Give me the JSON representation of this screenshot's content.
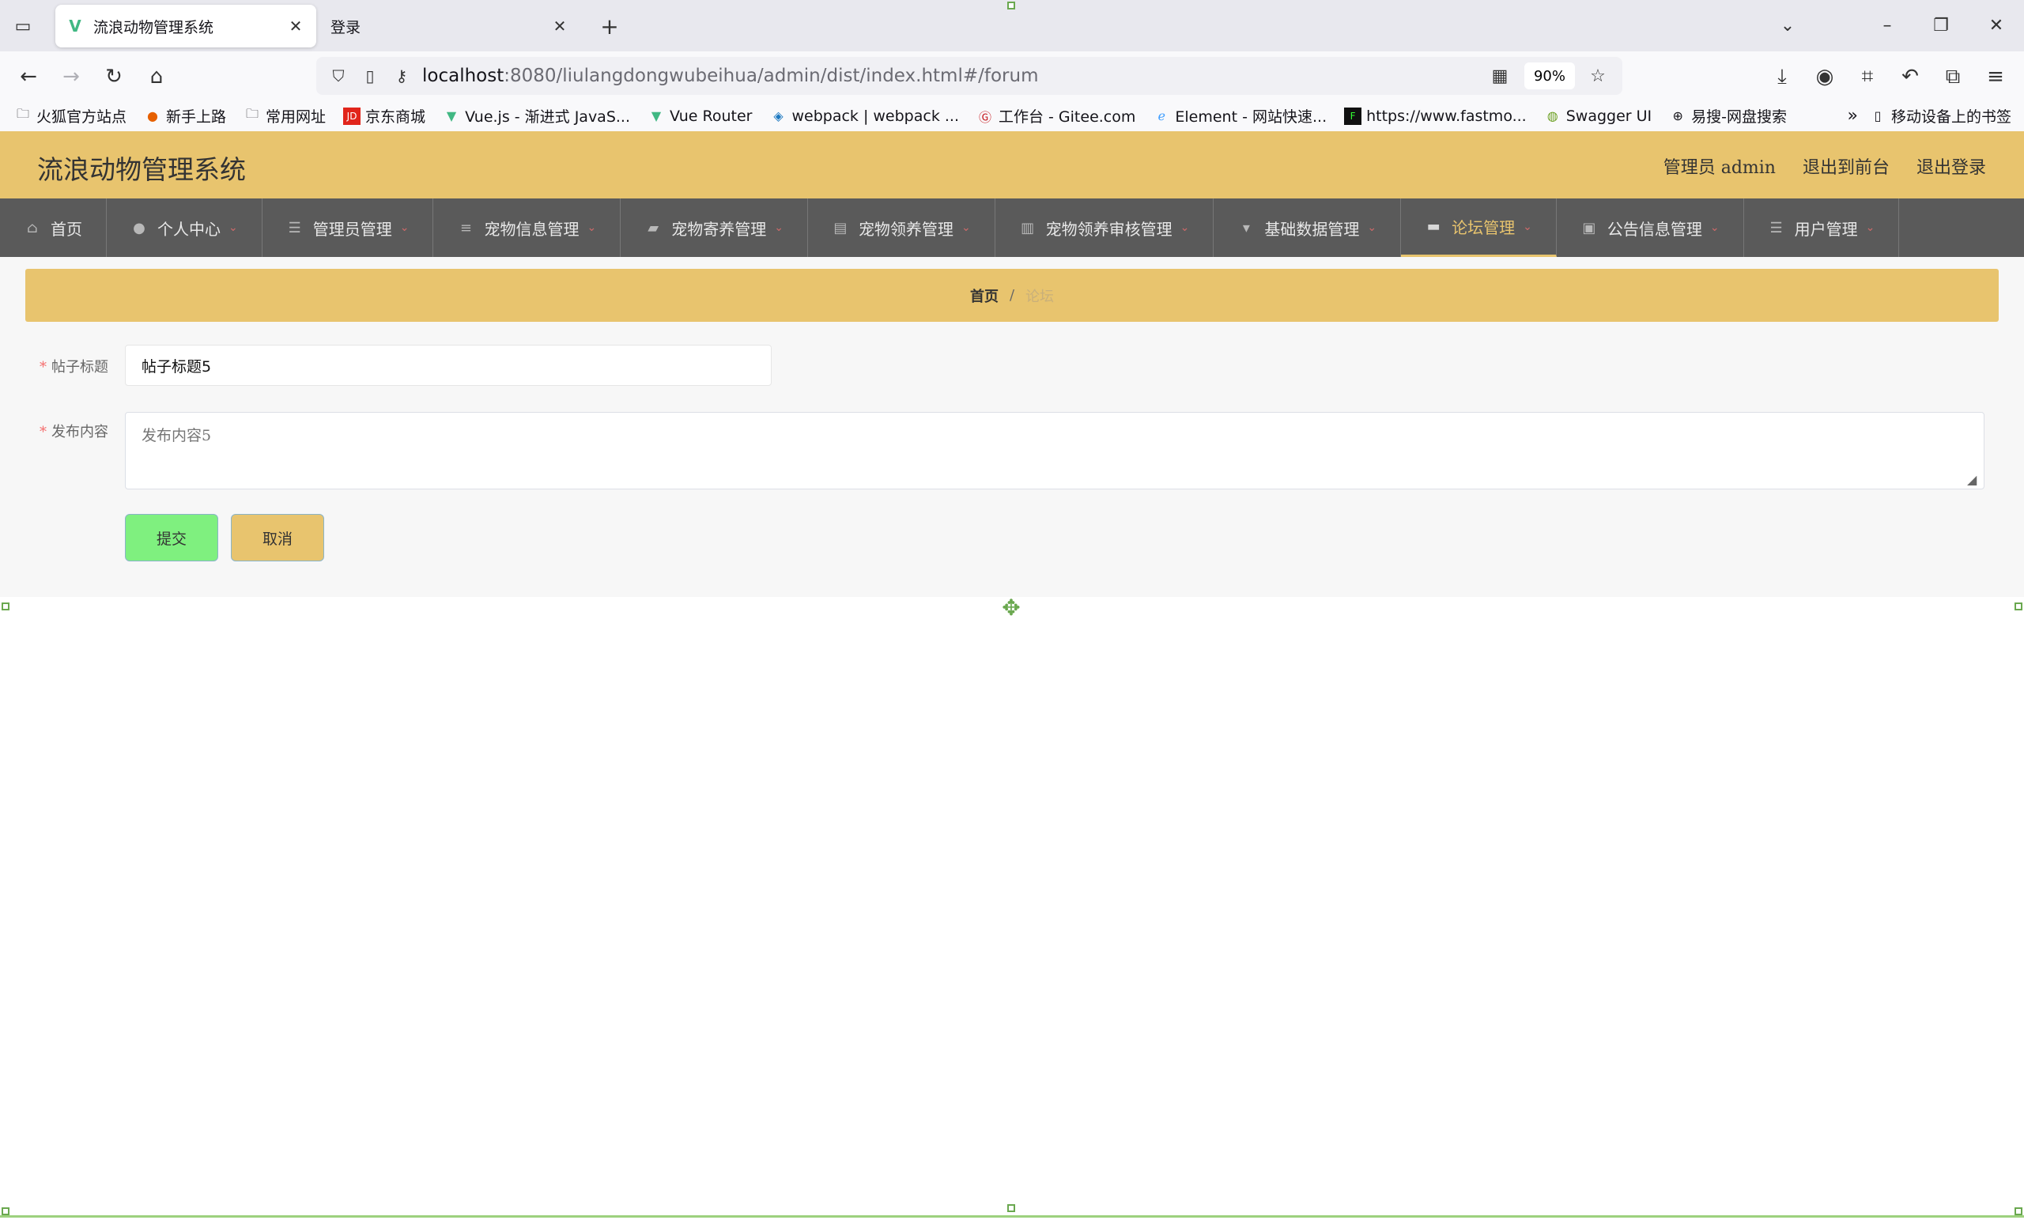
{
  "browser": {
    "tabs": [
      {
        "title": "流浪动物管理系统",
        "favicon": "vue-logo-icon",
        "active": true
      },
      {
        "title": "登录",
        "active": false
      }
    ],
    "url": {
      "host": "localhost",
      "path": ":8080/liulangdongwubeihua/admin/dist/index.html#/forum"
    },
    "zoom": "90%",
    "bookmarks": [
      {
        "label": "火狐官方站点",
        "icon": "folder-icon"
      },
      {
        "label": "新手上路",
        "icon": "firefox-icon"
      },
      {
        "label": "常用网址",
        "icon": "folder-icon"
      },
      {
        "label": "京东商城",
        "icon": "jd-icon"
      },
      {
        "label": "Vue.js - 渐进式 JavaS...",
        "icon": "vue-icon"
      },
      {
        "label": "Vue Router",
        "icon": "vue-icon"
      },
      {
        "label": "webpack | webpack ...",
        "icon": "webpack-icon"
      },
      {
        "label": "工作台 - Gitee.com",
        "icon": "gitee-icon"
      },
      {
        "label": "Element - 网站快速...",
        "icon": "element-icon"
      },
      {
        "label": "https://www.fastmo...",
        "icon": "fastmock-icon"
      },
      {
        "label": "Swagger UI",
        "icon": "swagger-icon"
      },
      {
        "label": "易搜-网盘搜索",
        "icon": "globe-icon"
      }
    ],
    "mobile_bookmarks": "移动设备上的书签"
  },
  "app": {
    "title": "流浪动物管理系统",
    "header_links": [
      "管理员 admin",
      "退出到前台",
      "退出登录"
    ],
    "menu": [
      {
        "label": "首页",
        "icon": "home-icon",
        "dropdown": false,
        "active": false
      },
      {
        "label": "个人中心",
        "icon": "user-icon",
        "dropdown": true,
        "active": false
      },
      {
        "label": "管理员管理",
        "icon": "sliders-icon",
        "dropdown": true,
        "active": false
      },
      {
        "label": "宠物信息管理",
        "icon": "list-icon",
        "dropdown": true,
        "active": false
      },
      {
        "label": "宠物寄养管理",
        "icon": "ticket-icon",
        "dropdown": true,
        "active": false
      },
      {
        "label": "宠物领养管理",
        "icon": "clipboard-icon",
        "dropdown": true,
        "active": false
      },
      {
        "label": "宠物领养审核管理",
        "icon": "book-icon",
        "dropdown": true,
        "active": false
      },
      {
        "label": "基础数据管理",
        "icon": "sign-icon",
        "dropdown": true,
        "active": false
      },
      {
        "label": "论坛管理",
        "icon": "inbox-icon",
        "dropdown": true,
        "active": true
      },
      {
        "label": "公告信息管理",
        "icon": "briefcase-icon",
        "dropdown": true,
        "active": false
      },
      {
        "label": "用户管理",
        "icon": "menu-icon",
        "dropdown": true,
        "active": false
      }
    ],
    "breadcrumb": {
      "home": "首页",
      "separator": "/",
      "current": "论坛"
    },
    "form": {
      "title_label": "帖子标题",
      "title_value": "帖子标题5",
      "content_label": "发布内容",
      "content_placeholder": "发布内容5",
      "submit_label": "提交",
      "cancel_label": "取消"
    }
  },
  "colors": {
    "header_bg": "#e8c46e",
    "menu_bg": "#5a5a5a",
    "active_menu": "#e8c46e",
    "submit_bg": "#7ff07f",
    "cancel_bg": "#e8c46e",
    "selection_handle": "#6aa84f"
  }
}
